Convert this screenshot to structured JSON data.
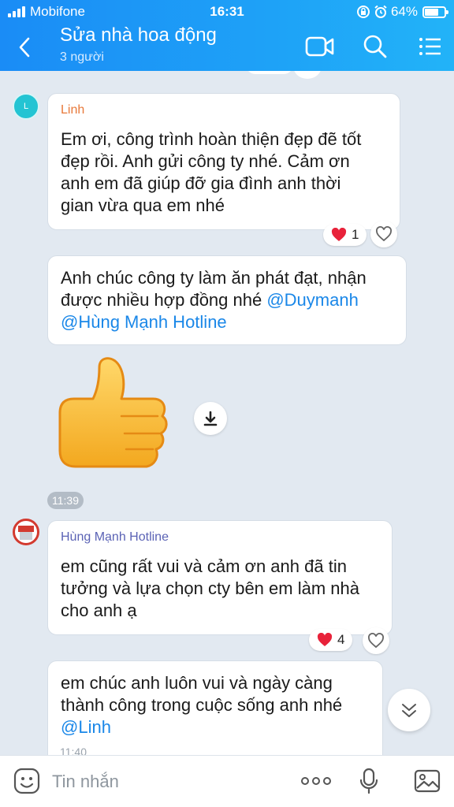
{
  "status_bar": {
    "carrier": "Mobifone",
    "time": "16:31",
    "battery": "64%"
  },
  "header": {
    "title": "Sửa nhà hoa động",
    "subtitle": "3 người"
  },
  "messages": [
    {
      "sender": "Linh",
      "avatar_letter": "L",
      "text": "Em ơi, công trình hoàn thiện đẹp đẽ tốt\nđẹp rồi. Anh gửi công ty nhé. Cảm ơn\nanh em đã giúp đỡ gia đình anh thời\ngian vừa qua em nhé",
      "reaction_count": "1"
    },
    {
      "text_prefix": "Anh chúc công ty làm ăn phát đạt, nhận\nđược nhiều hợp đồng nhé ",
      "mention_1": "@Duymanh",
      "mention_2": "@Hùng Mạnh Hotline"
    },
    {
      "sticker": "thumbs-up",
      "time": "11:39"
    },
    {
      "sender": "Hùng Mạnh Hotline",
      "text": "em cũng rất vui và cảm ơn anh đã tin\ntưởng và lựa chọn cty bên em làm nhà\ncho anh ạ",
      "reaction_count": "4"
    },
    {
      "text": "em chúc anh luôn vui và ngày càng\nthành công trong cuộc sống anh nhé",
      "mention": "@Linh",
      "time": "11:40"
    }
  ],
  "input": {
    "placeholder": "Tin nhắn"
  },
  "colors": {
    "header": "#1ea2f7",
    "mention": "#1a87e8",
    "sender_linh": "#e8793a",
    "sender_hung": "#5b63b5",
    "chat_bg": "#e2e9f1"
  }
}
